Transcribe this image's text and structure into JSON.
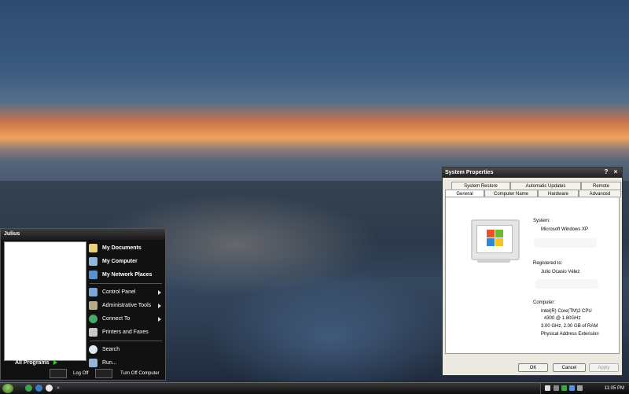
{
  "start_menu": {
    "user_name": "Julius",
    "all_programs": "All Programs",
    "pinned": [
      {
        "label": "My Documents",
        "icon": "documents-folder-icon"
      },
      {
        "label": "My Computer",
        "icon": "computer-icon"
      },
      {
        "label": "My Network Places",
        "icon": "network-icon"
      }
    ],
    "system": [
      {
        "label": "Control Panel",
        "icon": "control-panel-icon",
        "submenu": true
      },
      {
        "label": "Administrative Tools",
        "icon": "admin-tools-icon",
        "submenu": true
      },
      {
        "label": "Connect To",
        "icon": "globe-icon",
        "submenu": true
      },
      {
        "label": "Printers and Faxes",
        "icon": "printer-icon",
        "submenu": false
      }
    ],
    "tools": [
      {
        "label": "Search",
        "icon": "search-icon"
      },
      {
        "label": "Run...",
        "icon": "run-icon"
      }
    ],
    "log_off": "Log Off",
    "turn_off": "Turn Off Computer"
  },
  "dialog": {
    "title": "System Properties",
    "tabs_back": [
      "System Restore",
      "Automatic Updates",
      "Remote"
    ],
    "tabs_front": [
      "General",
      "Computer Name",
      "Hardware",
      "Advanced"
    ],
    "active_tab": "General",
    "system_label": "System:",
    "os": "Microsoft Windows XP",
    "registered_label": "Registered to:",
    "registered_name": "Julio Ocasio Vélez",
    "computer_label": "Computer:",
    "cpu_line1": "Intel(R) Core(TM)2 CPU",
    "cpu_line2": "4300  @ 1.80GHz",
    "cpu_line3": "3.00 GHz, 2.00 GB of RAM",
    "cpu_line4": "Physical Address Extension",
    "ok": "OK",
    "cancel": "Cancel",
    "apply": "Apply"
  },
  "taskbar": {
    "quick_launch_more": "»",
    "clock": "11:05 PM"
  },
  "colors": {
    "accent_green": "#3c3",
    "dialog_bg": "#ece9e0"
  }
}
